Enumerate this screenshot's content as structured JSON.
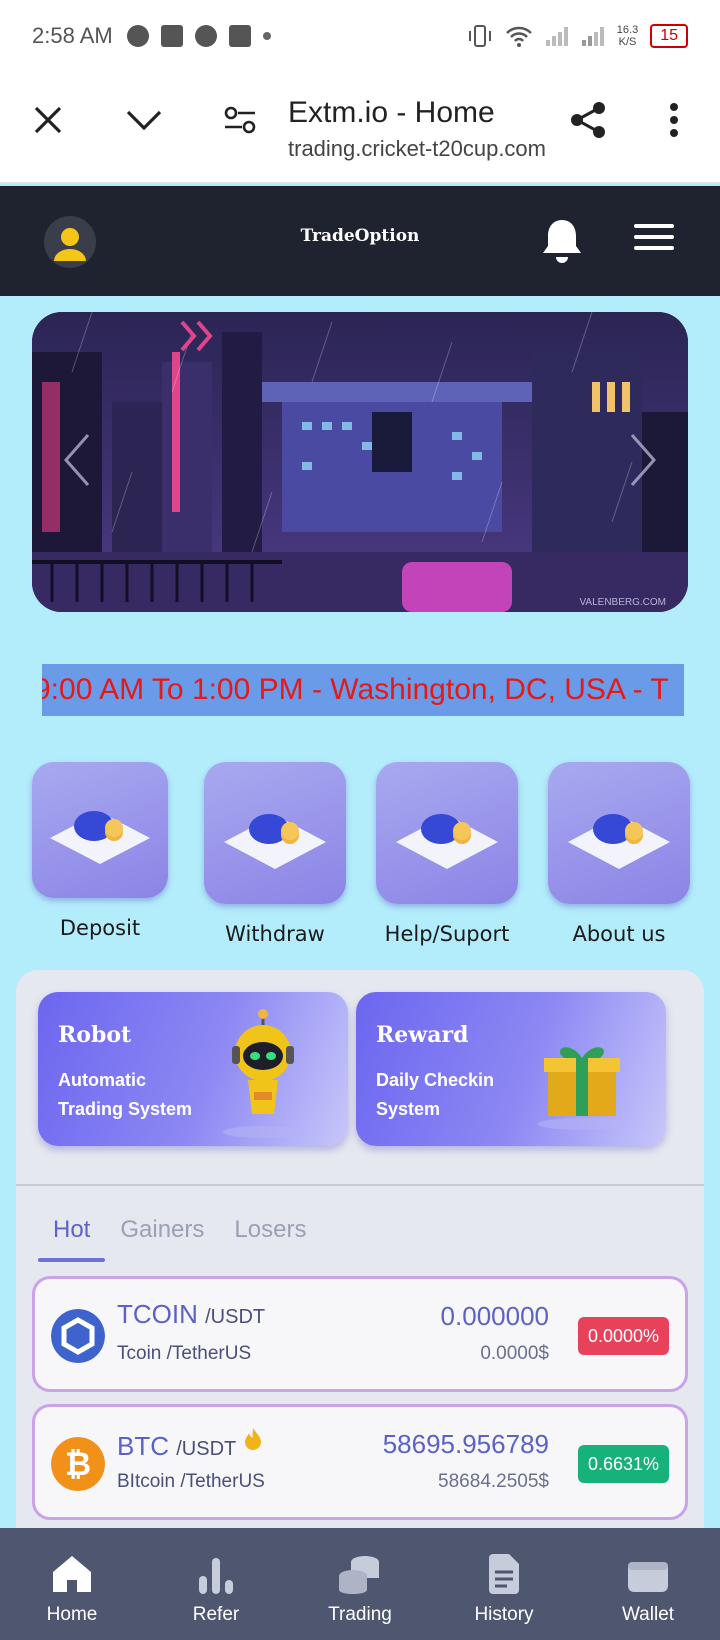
{
  "status_bar": {
    "time": "2:58 AM",
    "net_speed": "16.3",
    "net_unit": "K/S",
    "battery": "15"
  },
  "browser": {
    "title": "Extm.io - Home",
    "url": "trading.cricket-t20cup.com"
  },
  "app_header": {
    "logo": "TradeOption",
    "icons": [
      "user-avatar-icon",
      "bell-icon",
      "menu-icon"
    ]
  },
  "banner": {
    "watermark": "VALENBERG.COM"
  },
  "marquee": {
    "text": "9:00 AM To 1:00 PM - Washington, DC, USA - T"
  },
  "quick_actions": [
    {
      "label": "Deposit"
    },
    {
      "label": "Withdraw"
    },
    {
      "label": "Help/Suport"
    },
    {
      "label": "About us"
    }
  ],
  "promos": [
    {
      "title": "Robot",
      "subtitle": "Automatic Trading System"
    },
    {
      "title": "Reward",
      "subtitle": "Daily Checkin System"
    }
  ],
  "tabs": [
    {
      "label": "Hot",
      "active": true
    },
    {
      "label": "Gainers"
    },
    {
      "label": "Losers"
    }
  ],
  "coins": [
    {
      "symbol": "TCOIN",
      "pair": "/USDT",
      "name": "Tcoin /TetherUS",
      "price": "0.000000",
      "usd": "0.0000$",
      "change": "0.0000%",
      "change_color": "#e8415a"
    },
    {
      "symbol": "BTC",
      "pair": "/USDT",
      "name": "BItcoin /TetherUS",
      "price": "58695.956789",
      "usd": "58684.2505$",
      "change": "0.6631%",
      "change_color": "#17b17a"
    }
  ],
  "bottom_nav": [
    {
      "label": "Home"
    },
    {
      "label": "Refer"
    },
    {
      "label": "Trading"
    },
    {
      "label": "History"
    },
    {
      "label": "Wallet"
    }
  ]
}
